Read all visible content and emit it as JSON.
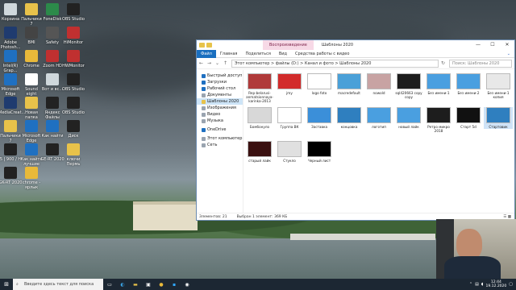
{
  "desktop_icons": [
    {
      "label": "Корзина",
      "color": "#cfd8dc"
    },
    {
      "label": "Пальчики 7",
      "color": "#e8c24a"
    },
    {
      "label": "FoneDisk",
      "color": "#2c8a4a"
    },
    {
      "label": "OBS Studio",
      "color": "#222222"
    },
    {
      "label": "Adobe Photosh...",
      "color": "#1f3b6f"
    },
    {
      "label": "BMI",
      "color": "#444444"
    },
    {
      "label": "Safety",
      "color": "#555555"
    },
    {
      "label": "HiMonitor",
      "color": "#c03030"
    },
    {
      "label": "Intel(R) Grap...",
      "color": "#1f70c1"
    },
    {
      "label": "Chrome",
      "color": "#e8b93a"
    },
    {
      "label": "Zoom HD",
      "color": "#c03030"
    },
    {
      "label": "HWMonitor",
      "color": "#c03030"
    },
    {
      "label": "Microsoft Edge",
      "color": "#1f70c1"
    },
    {
      "label": "Sound eight",
      "color": "#ffffff"
    },
    {
      "label": "Вот и вс...",
      "color": "#cfd8dc"
    },
    {
      "label": "OBS Studio",
      "color": "#222222"
    },
    {
      "label": "MediaCreat...",
      "color": "#1f3b6f"
    },
    {
      "label": "Новая папка",
      "color": "#e8c24a"
    },
    {
      "label": "Яндекс Файлы",
      "color": "#222222"
    },
    {
      "label": "OBS Studio",
      "color": "#222222"
    },
    {
      "label": "Пальчики 7",
      "color": "#e8c24a"
    },
    {
      "label": "Microsoft Edge",
      "color": "#1f70c1"
    },
    {
      "label": "Как найти",
      "color": "#1f70c1"
    },
    {
      "label": "Диск",
      "color": "#222222"
    },
    {
      "label": "5 | 900 / Н",
      "color": "#222222"
    },
    {
      "label": "Как найти лучшие",
      "color": "#1f70c1"
    },
    {
      "label": "GE-RT 2020",
      "color": "#222222"
    },
    {
      "label": "ключи Пермь",
      "color": "#e8c24a"
    },
    {
      "label": "GK-RT 2020",
      "color": "#222222"
    },
    {
      "label": "chrome - ярлык",
      "color": "#e8b93a"
    }
  ],
  "window": {
    "context_tab": "Воспроизведение",
    "title": "Шаблоны 2020",
    "ribbon_tabs": [
      "Файл",
      "Главная",
      "Поделиться",
      "Вид",
      "Средства работы с видео"
    ],
    "address": "Этот компьютер > файлы (D:) > Канал и фото > Шаблоны 2020",
    "search_placeholder": "Поиск: Шаблоны 2020",
    "nav_items": [
      {
        "label": "Быстрый доступ",
        "color": "#1f70c1"
      },
      {
        "label": "Загрузки",
        "color": "#1f70c1"
      },
      {
        "label": "Рабочий стол",
        "color": "#1f70c1"
      },
      {
        "label": "Документы",
        "color": "#9aa4b0"
      },
      {
        "label": "Шаблоны 2020",
        "color": "#e8c24a"
      },
      {
        "label": "Изображения",
        "color": "#9aa4b0"
      },
      {
        "label": "Видео",
        "color": "#9aa4b0"
      },
      {
        "label": "Музыка",
        "color": "#9aa4b0"
      },
      {
        "label": "OneDrive",
        "color": "#1f70c1"
      },
      {
        "label": "Этот компьютер",
        "color": "#9aa4b0"
      },
      {
        "label": "Сеть",
        "color": "#9aa4b0"
      }
    ],
    "files": [
      {
        "label": "Rep-belarusi-anmatsionnaya-karinka-2013",
        "color": "#b03a3a"
      },
      {
        "label": "jmy",
        "color": "#d22b2b"
      },
      {
        "label": "logo foto",
        "color": "#ffffff"
      },
      {
        "label": "macredefault",
        "color": "#4aa0d8"
      },
      {
        "label": "nowold",
        "color": "#c8a3a3"
      },
      {
        "label": "sql420663 copy copy",
        "color": "#1d1d1d"
      },
      {
        "label": "Без имени-1",
        "color": "#4a9fe0"
      },
      {
        "label": "Без имени-2",
        "color": "#4a9fe0"
      },
      {
        "label": "Без имени-1 копия",
        "color": "#e8e8e8"
      },
      {
        "label": "Бомбонуло",
        "color": "#d8d8d8"
      },
      {
        "label": "Группа ВК",
        "color": "#ffffff"
      },
      {
        "label": "Заставка",
        "color": "#3b8fd9"
      },
      {
        "label": "концовка",
        "color": "#2f7fbf"
      },
      {
        "label": "логотип",
        "color": "#4a9fe0"
      },
      {
        "label": "новый лайк",
        "color": "#4a9fe0"
      },
      {
        "label": "Ретро микро 2018",
        "color": "#1d1d1d"
      },
      {
        "label": "Старт 5d",
        "color": "#111111"
      },
      {
        "label": "Стартовик",
        "color": "#2f7fbf"
      },
      {
        "label": "старый лайк",
        "color": "#3a1010"
      },
      {
        "label": "Стукло",
        "color": "#e0e0e0"
      },
      {
        "label": "Черный лист",
        "color": "#000000"
      }
    ],
    "status_items": "Элементов: 21",
    "status_selected": "Выбран 1 элемент: 369 КБ"
  },
  "taskbar": {
    "search_placeholder": "Введите здесь текст для поиска",
    "time": "12:44",
    "date": "19.12.2020"
  }
}
